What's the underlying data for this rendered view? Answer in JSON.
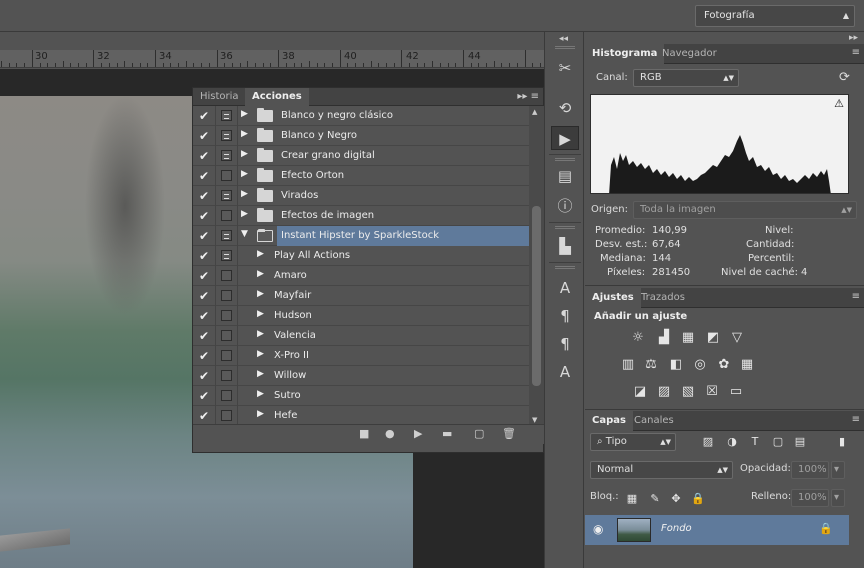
{
  "workspace": {
    "selected": "Fotografía"
  },
  "ruler": {
    "marks": [
      "30",
      "32",
      "34",
      "36",
      "38",
      "40",
      "42",
      "44"
    ]
  },
  "actions_panel": {
    "tabs": [
      "Historia",
      "Acciones"
    ],
    "active_tab": "Acciones",
    "items": [
      {
        "name": "Blanco y negro clásico",
        "type": "set",
        "expanded": false,
        "dialog": true,
        "selected": false
      },
      {
        "name": "Blanco y Negro",
        "type": "set",
        "expanded": false,
        "dialog": true,
        "selected": false
      },
      {
        "name": "Crear grano digital",
        "type": "set",
        "expanded": false,
        "dialog": true,
        "selected": false
      },
      {
        "name": "Efecto Orton",
        "type": "set",
        "expanded": false,
        "dialog": false,
        "selected": false
      },
      {
        "name": "Virados",
        "type": "set",
        "expanded": false,
        "dialog": true,
        "selected": false
      },
      {
        "name": "Efectos de imagen",
        "type": "set",
        "expanded": false,
        "dialog": false,
        "selected": false
      },
      {
        "name": "Instant Hipster by SparkleStock",
        "type": "set",
        "expanded": true,
        "dialog": true,
        "selected": true
      },
      {
        "name": "Play All Actions",
        "type": "action",
        "dialog": true,
        "selected": false
      },
      {
        "name": "Amaro",
        "type": "action",
        "dialog": false,
        "selected": false
      },
      {
        "name": "Mayfair",
        "type": "action",
        "dialog": false,
        "selected": false
      },
      {
        "name": "Hudson",
        "type": "action",
        "dialog": false,
        "selected": false
      },
      {
        "name": "Valencia",
        "type": "action",
        "dialog": false,
        "selected": false
      },
      {
        "name": "X-Pro II",
        "type": "action",
        "dialog": false,
        "selected": false
      },
      {
        "name": "Willow",
        "type": "action",
        "dialog": false,
        "selected": false
      },
      {
        "name": "Sutro",
        "type": "action",
        "dialog": false,
        "selected": false
      },
      {
        "name": "Hefe",
        "type": "action",
        "dialog": false,
        "selected": false
      }
    ]
  },
  "histogram_panel": {
    "tabs": [
      "Histograma",
      "Navegador"
    ],
    "channel_label": "Canal:",
    "channel_value": "RGB",
    "source_label": "Origen:",
    "source_value": "Toda la imagen",
    "stats": {
      "mean_label": "Promedio:",
      "mean": "140,99",
      "stddev_label": "Desv. est.:",
      "stddev": "67,64",
      "median_label": "Mediana:",
      "median": "144",
      "pixels_label": "Píxeles:",
      "pixels": "281450",
      "level_label": "Nivel:",
      "level": "",
      "count_label": "Cantidad:",
      "count": "",
      "percentile_label": "Percentil:",
      "percentile": "",
      "cache_label": "Nivel de caché:",
      "cache": "4"
    }
  },
  "adjustments_panel": {
    "tabs": [
      "Ajustes",
      "Trazados"
    ],
    "heading": "Añadir un ajuste"
  },
  "layers_panel": {
    "tabs": [
      "Capas",
      "Canales"
    ],
    "filter_kind": "Tipo",
    "blend_mode": "Normal",
    "opacity_label": "Opacidad:",
    "opacity": "100%",
    "lock_label": "Bloq.:",
    "fill_label": "Relleno:",
    "fill": "100%",
    "layers": [
      {
        "name": "Fondo",
        "visible": true,
        "locked": true
      }
    ]
  },
  "colors": {
    "selection": "#5f7a9b",
    "panel": "#535353",
    "tab_bar": "#434343"
  }
}
